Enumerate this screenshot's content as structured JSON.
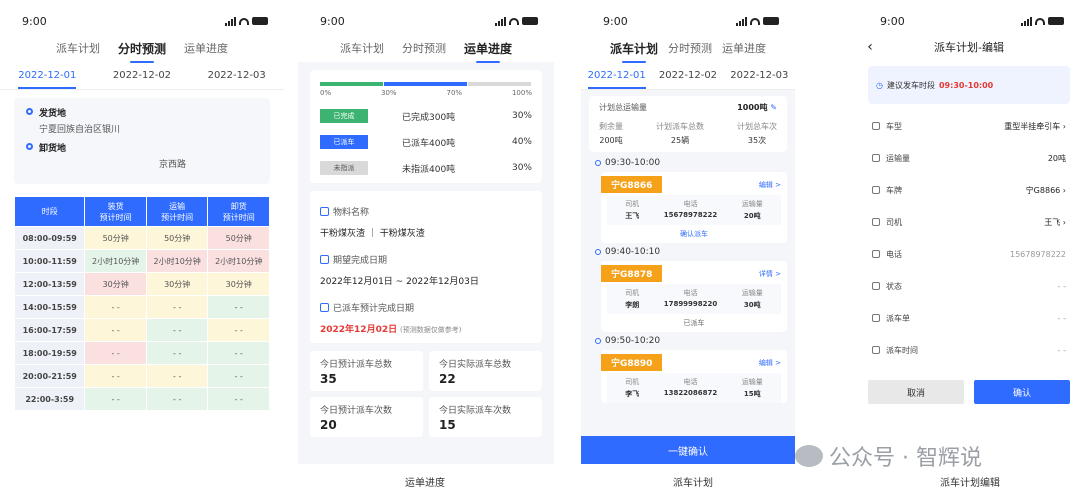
{
  "status_time": "9:00",
  "p1": {
    "tabs": [
      "派车计划",
      "分时预测",
      "运单进度"
    ],
    "active_tab": 1,
    "dates": [
      "2022-12-01",
      "2022-12-02",
      "2022-12-03"
    ],
    "from_label": "发货地",
    "from_value": "宁夏回族自治区银川",
    "to_label": "卸货地",
    "to_value": "京西路",
    "headers": [
      "时段",
      "装货\n预计时间",
      "运输\n预计时间",
      "卸货\n预计时间"
    ],
    "rows": [
      {
        "time": "08:00-09:59",
        "a": "50分钟",
        "b": "50分钟",
        "c": "50分钟",
        "ca": "cy",
        "cb": "cy",
        "cc": "cr"
      },
      {
        "time": "10:00-11:59",
        "a": "2小时10分钟",
        "b": "2小时10分钟",
        "c": "2小时10分钟",
        "ca": "cg",
        "cb": "cr",
        "cc": "cr"
      },
      {
        "time": "12:00-13:59",
        "a": "30分钟",
        "b": "30分钟",
        "c": "30分钟",
        "ca": "cr",
        "cb": "cy",
        "cc": "cy"
      },
      {
        "time": "14:00-15:59",
        "a": "- -",
        "b": "- -",
        "c": "- -",
        "ca": "cy",
        "cb": "cy",
        "cc": "cg"
      },
      {
        "time": "16:00-17:59",
        "a": "- -",
        "b": "- -",
        "c": "- -",
        "ca": "cy",
        "cb": "cg",
        "cc": "cy"
      },
      {
        "time": "18:00-19:59",
        "a": "- -",
        "b": "- -",
        "c": "- -",
        "ca": "cr",
        "cb": "cg",
        "cc": "cg"
      },
      {
        "time": "20:00-21:59",
        "a": "- -",
        "b": "- -",
        "c": "- -",
        "ca": "cy",
        "cb": "cy",
        "cc": "cg"
      },
      {
        "time": "22:00-3:59",
        "a": "- -",
        "b": "- -",
        "c": "- -",
        "ca": "cg",
        "cb": "cg",
        "cc": "cg"
      }
    ]
  },
  "p2": {
    "tabs": [
      "派车计划",
      "分时预测",
      "运单进度"
    ],
    "active_tab": 2,
    "progress": {
      "ticks": [
        "0%",
        "30%",
        "70%",
        "100%"
      ],
      "segments": [
        {
          "pct": 30,
          "color": "#3cb371"
        },
        {
          "pct": 40,
          "color": "#2f6bff"
        },
        {
          "pct": 30,
          "color": "#d9d9d9"
        }
      ]
    },
    "status_rows": [
      {
        "badge": "已完成",
        "text": "已完成300吨",
        "pct": "30%",
        "bg": "#3cb371",
        "fg": "#fff"
      },
      {
        "badge": "已派车",
        "text": "已派车400吨",
        "pct": "40%",
        "bg": "#2f6bff",
        "fg": "#fff"
      },
      {
        "badge": "未指派",
        "text": "未指派400吨",
        "pct": "30%",
        "bg": "#d9d9d9",
        "fg": "#555"
      }
    ],
    "material_label": "物料名称",
    "material_value": "干粉煤灰渣 ｜ 干粉煤灰渣",
    "period_label": "期望完成日期",
    "period_value": "2022年12月01日 ~ 2022年12月03日",
    "est_label": "已派车预计完成日期",
    "est_value": "2022年12月02日",
    "est_note": "(预测数据仅做参考)",
    "stats": [
      {
        "label": "今日预计派车总数",
        "value": "35"
      },
      {
        "label": "今日实际派车总数",
        "value": "22"
      },
      {
        "label": "今日预计派车次数",
        "value": "20"
      },
      {
        "label": "今日实际派车次数",
        "value": "15"
      }
    ],
    "caption": "运单进度"
  },
  "p3": {
    "tabs": [
      "派车计划",
      "分时预测",
      "运单进度"
    ],
    "active_tab": 0,
    "dates": [
      "2022-12-01",
      "2022-12-02",
      "2022-12-03"
    ],
    "plan_label": "计划总运输量",
    "plan_value": "1000吨",
    "plan_grid": [
      {
        "k": "剩余量",
        "v": "200吨"
      },
      {
        "k": "计划派车总数",
        "v": "25辆"
      },
      {
        "k": "计划总车次",
        "v": "35次"
      }
    ],
    "slots": [
      {
        "time": "09:30-10:00",
        "plate": "宁G8866",
        "link": "编辑 >",
        "driver": "王飞",
        "phone": "15678978222",
        "qty": "20吨",
        "foot": "确认派车",
        "blue": true
      },
      {
        "time": "09:40-10:10",
        "plate": "宁G8878",
        "link": "详情 >",
        "driver": "李朗",
        "phone": "17899998220",
        "qty": "30吨",
        "foot": "已派车",
        "blue": false
      },
      {
        "time": "09:50-10:20",
        "plate": "宁G8890",
        "link": "编辑 >",
        "driver": "李飞",
        "phone": "13822086872",
        "qty": "15吨",
        "foot": "",
        "blue": true
      }
    ],
    "col_labels": [
      "司机",
      "电话",
      "运输量"
    ],
    "big_button": "一键确认",
    "caption": "派车计划"
  },
  "p4": {
    "title": "派车计划-编辑",
    "suggest_label": "建议发车时段",
    "suggest_value": "09:30-10:00",
    "fields": [
      {
        "label": "车型",
        "value": "重型半挂牵引车 ›",
        "light": false
      },
      {
        "label": "运输量",
        "value": "20吨",
        "light": false
      },
      {
        "label": "车牌",
        "value": "宁G8866 ›",
        "light": false
      },
      {
        "label": "司机",
        "value": "王飞 ›",
        "light": false
      },
      {
        "label": "电话",
        "value": "15678978222",
        "light": true
      },
      {
        "label": "状态",
        "value": "- -",
        "light": true
      },
      {
        "label": "派车单",
        "value": "- -",
        "light": true
      },
      {
        "label": "派车时间",
        "value": "- -",
        "light": true
      }
    ],
    "cancel": "取消",
    "confirm": "确认",
    "caption": "派车计划编辑"
  },
  "watermark": "公众号 · 智辉说"
}
